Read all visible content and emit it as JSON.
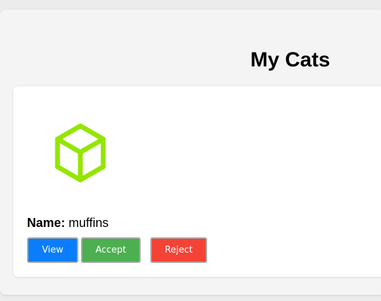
{
  "header": {
    "title": "My Cats"
  },
  "cat_card": {
    "image_icon": "cube-icon",
    "image_color": "#94e600",
    "name_label": "Name:",
    "name_value": "muffins",
    "buttons": {
      "view_label": "View",
      "accept_label": "Accept",
      "reject_label": "Reject"
    }
  },
  "colors": {
    "view": "#0b7dfb",
    "accept": "#4caf50",
    "reject": "#f44336"
  }
}
